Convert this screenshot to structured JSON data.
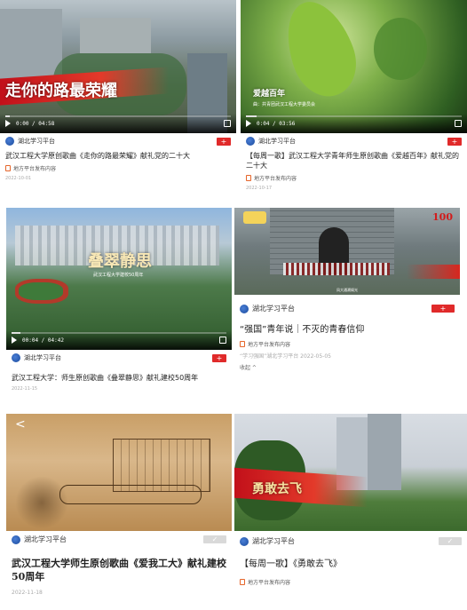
{
  "cards": [
    {
      "overlay": "走你的路最荣耀",
      "time": "0:00 / 04:58",
      "progress": 0.02,
      "publisher": "湖北学习平台",
      "follow": "+",
      "title": "武汉工程大学原创歌曲《走你的路最荣耀》献礼党的二十大",
      "source": "地方平台发布内容",
      "date": "2022-10-01"
    },
    {
      "overlay": "爱越百年",
      "caption": "曲：共青团武汉工程大学委员会",
      "time": "0:04 / 03:56",
      "progress": 0.05,
      "publisher": "湖北学习平台",
      "follow": "+",
      "title": "【每周一歌】武汉工程大学青年师生原创歌曲《爱越百年》献礼党的二十大",
      "source": "地方平台发布内容",
      "date": "2022-10-17"
    },
    {
      "overlay": "叠翠静思",
      "caption": "武汉工程大学建校50周年",
      "time": "00:04 / 04:42",
      "progress": 0.04,
      "publisher": "湖北学习平台",
      "follow": "+",
      "title": "武汉工程大学：师生原创歌曲《叠翠静思》献礼建校50周年",
      "date": "2022-11-15"
    },
    {
      "badge": "100",
      "caption": "凤大通溯阁光",
      "publisher": "湖北学习平台",
      "follow": "+",
      "title": "“强国”青年说｜不灭的青春信仰",
      "source": "地方平台发布内容",
      "meta": "“学习强国”湖北学习平台 2022-05-05",
      "collapse": "收起 ^"
    },
    {
      "back": "<",
      "publisher": "湖北学习平台",
      "follow": "✓",
      "title": "武汉工程大学师生原创歌曲《爱我工大》献礼建校50周年",
      "date": "2022-11-18"
    },
    {
      "overlay": "勇敢去飞",
      "publisher": "湖北学习平台",
      "follow": "✓",
      "title": "【每周一歌】《勇敢去飞》",
      "source": "地方平台发布内容"
    }
  ]
}
